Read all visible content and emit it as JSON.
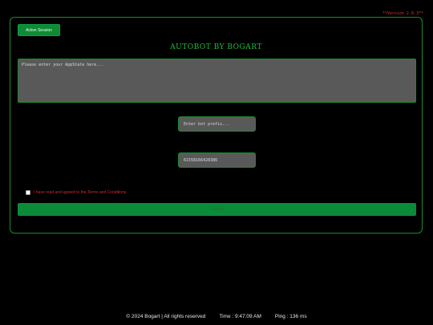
{
  "version_label": "**Version 2.0.3**",
  "session_button": {
    "label": "Active Session"
  },
  "title": "AUTOBOT BY BOGART",
  "appstate": {
    "placeholder": "Please enter your AppState here..."
  },
  "prefix": {
    "placeholder": "Enter bot prefix..."
  },
  "uid": {
    "value": "61558166428386"
  },
  "terms": {
    "label": "I have read and agreed to the Terms and Conditions",
    "checked": false
  },
  "submit_button": {
    "label": "Submit"
  },
  "footer": {
    "copyright": "© 2024 Bogart | All rights reserved",
    "time": "Time : 9:47:09 AM",
    "ping": "Ping : 136 ms"
  },
  "colors": {
    "accent": "#0f8a35",
    "title": "#1fbf3a",
    "warning": "#d22a2a",
    "input_bg": "#595959"
  }
}
